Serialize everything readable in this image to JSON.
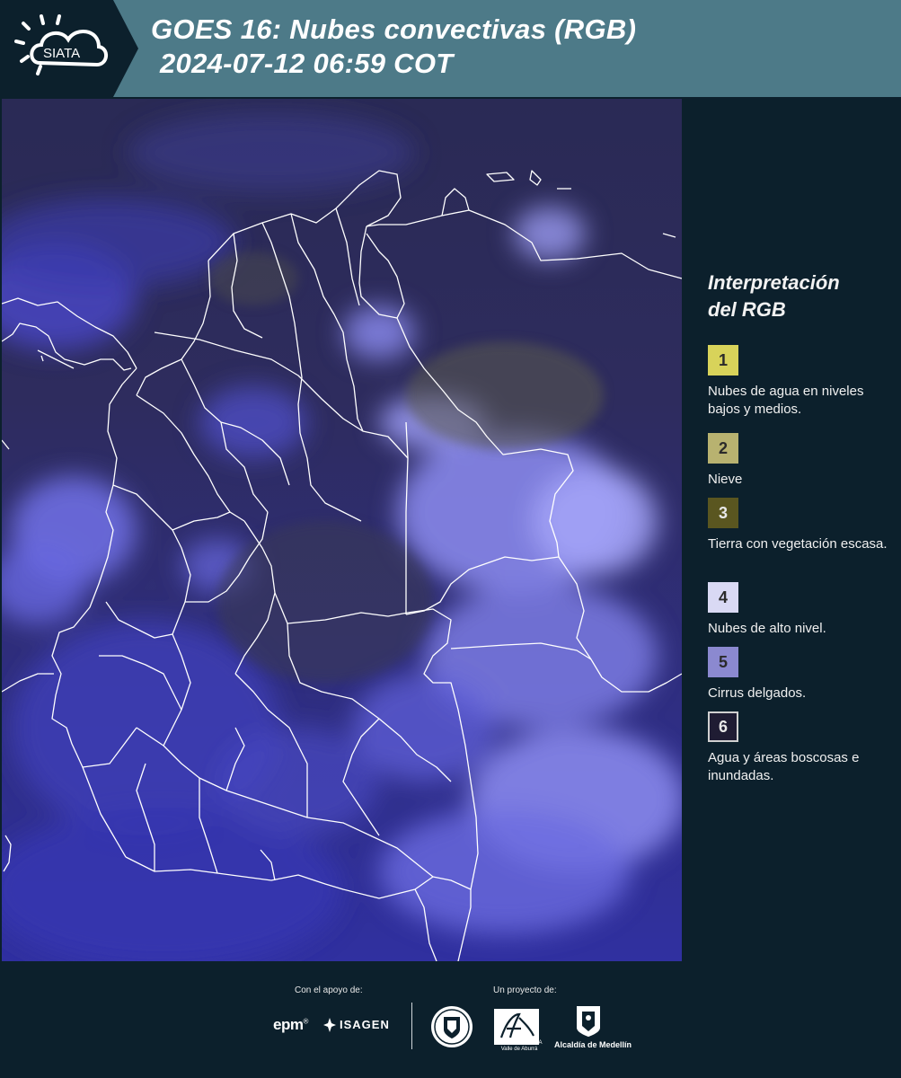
{
  "header": {
    "logo_text": "SIATA",
    "title_line1": "GOES 16: Nubes convectivas (RGB)",
    "title_line2": "2024-07-12 06:59 COT",
    "background_color": "#4d7a88"
  },
  "legend": {
    "title_line1": "Interpretación",
    "title_line2": "del RGB",
    "items": [
      {
        "number": "1",
        "label": "Nubes de agua en niveles bajos y medios.",
        "color": "#d8d35a"
      },
      {
        "number": "2",
        "label": "Nieve",
        "color": "#b8b270"
      },
      {
        "number": "3",
        "label": "Tierra con vegetación escasa.",
        "color": "#5a5620"
      },
      {
        "number": "4",
        "label": "Nubes de alto nivel.",
        "color": "#d9d9f4"
      },
      {
        "number": "5",
        "label": "Cirrus delgados.",
        "color": "#8b89d0"
      },
      {
        "number": "6",
        "label": "Agua y áreas boscosas e inundadas.",
        "color": "#1f1c33"
      }
    ]
  },
  "footer": {
    "support_label": "Con el apoyo de:",
    "project_label": "Un proyecto de:",
    "epm_text": "epm",
    "isagen_text": "ISAGEN",
    "area_text_1": "METROPOLITANA",
    "area_text_2": "Valle de Aburrá",
    "alcaldia_text": "Alcaldía de Medellín"
  },
  "map": {
    "border_color": "#ffffff",
    "cloud_color": "#5858e0"
  }
}
